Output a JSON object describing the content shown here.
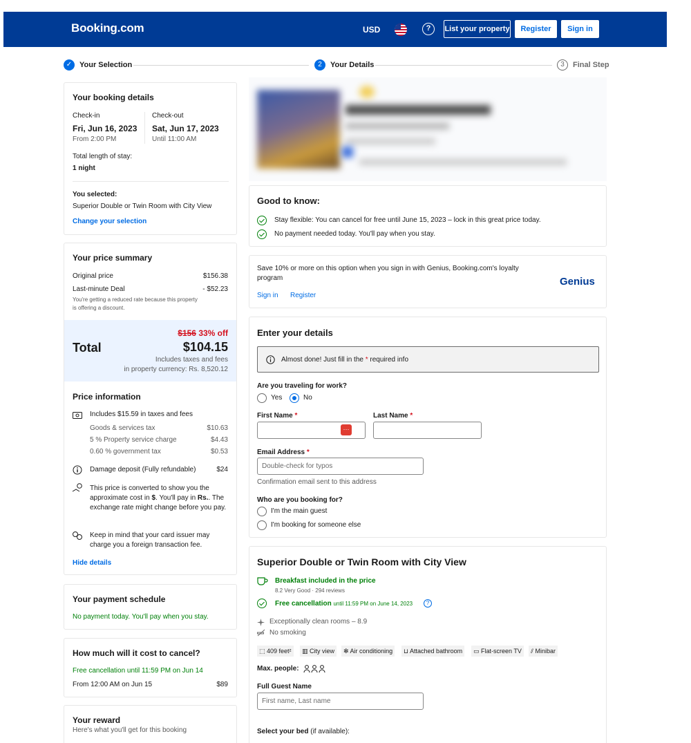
{
  "header": {
    "logo": "Booking.com",
    "currency": "USD",
    "help": "?",
    "list_property": "List your property",
    "register": "Register",
    "sign_in": "Sign in"
  },
  "progress": {
    "steps": [
      {
        "label": "Your Selection",
        "marker": "✓"
      },
      {
        "label": "Your Details",
        "marker": "2"
      },
      {
        "label": "Final Step",
        "marker": "3"
      }
    ]
  },
  "booking_details": {
    "title": "Your booking details",
    "checkin_label": "Check-in",
    "checkin_date": "Fri, Jun 16, 2023",
    "checkin_time": "From 2:00 PM",
    "checkout_label": "Check-out",
    "checkout_date": "Sat, Jun 17, 2023",
    "checkout_time": "Until 11:00 AM",
    "length_label": "Total length of stay:",
    "length_value": "1 night",
    "selected_label": "You selected:",
    "selected_value": "Superior Double or Twin Room with City View",
    "change_link": "Change your selection"
  },
  "price_summary": {
    "title": "Your price summary",
    "original_label": "Original price",
    "original_value": "$156.38",
    "deal_label": "Last-minute Deal",
    "deal_value": "- $52.23",
    "deal_note": "You're getting a reduced rate because this property is offering a discount.",
    "strike_price": "$156",
    "discount": "33% off",
    "total_label": "Total",
    "total_value": "$104.15",
    "taxes_note": "Includes taxes and fees",
    "property_currency": "in property currency: Rs. 8,520.12"
  },
  "price_info": {
    "title": "Price information",
    "taxes_line": "Includes $15.59 in taxes and fees",
    "tax_rows": [
      {
        "label": "Goods & services tax",
        "value": "$10.63"
      },
      {
        "label": "5 % Property service charge",
        "value": "$4.43"
      },
      {
        "label": "0.60 % government tax",
        "value": "$0.53"
      }
    ],
    "damage_label": "Damage deposit (Fully refundable)",
    "damage_value": "$24",
    "convert_pre": "This price is converted to show you the approximate cost in ",
    "convert_cur": "$",
    "convert_mid": ". You'll pay in ",
    "convert_pay": "Rs.",
    "convert_post": ". The exchange rate might change before you pay.",
    "card_note": "Keep in mind that your card issuer may charge you a foreign transaction fee.",
    "hide_link": "Hide details"
  },
  "payment_schedule": {
    "title": "Your payment schedule",
    "note": "No payment today. You'll pay when you stay."
  },
  "cancel_cost": {
    "title": "How much will it cost to cancel?",
    "free_note": "Free cancellation until 11:59 PM on Jun 14",
    "from_label": "From 12:00 AM on Jun 15",
    "from_value": "$89"
  },
  "reward": {
    "title": "Your reward",
    "subtitle": "Here's what you'll get for this booking"
  },
  "good_to_know": {
    "title": "Good to know:",
    "items": [
      "Stay flexible: You can cancel for free until June 15, 2023 – lock in this great price today.",
      "No payment needed today. You'll pay when you stay."
    ]
  },
  "genius": {
    "text": "Save 10% or more on this option when you sign in with Genius, Booking.com's loyalty program",
    "sign_in": "Sign in",
    "register": "Register",
    "logo": "Genius"
  },
  "details_form": {
    "title": "Enter your details",
    "info_pre": "Almost done! Just fill in the ",
    "info_star": "*",
    "info_post": " required info",
    "work_question": "Are you traveling for work?",
    "yes": "Yes",
    "no": "No",
    "first_name": "First Name",
    "last_name": "Last Name",
    "required": "*",
    "email_label": "Email Address",
    "email_placeholder": "Double-check for typos",
    "email_note": "Confirmation email sent to this address",
    "booking_for": "Who are you booking for?",
    "main_guest": "I'm the main guest",
    "someone_else": "I'm booking for someone else"
  },
  "room": {
    "title": "Superior Double or Twin Room with City View",
    "breakfast": "Breakfast included in the price",
    "rating": "8.2 Very Good",
    "reviews": "294 reviews",
    "free_cancel": "Free cancellation",
    "free_cancel_until": "until 11:59 PM on June 14, 2023",
    "clean": "Exceptionally clean rooms – 8.9",
    "smoking": "No smoking",
    "amenities": [
      "409 feet²",
      "City view",
      "Air conditioning",
      "Attached bathroom",
      "Flat-screen TV",
      "Minibar"
    ],
    "max_people": "Max. people:",
    "guest_name_label": "Full Guest Name",
    "guest_name_placeholder": "First name, Last name",
    "bed_label": "Select your bed",
    "bed_note": " (if available):"
  },
  "colors": {
    "brand": "#003b95",
    "link": "#006ce4",
    "green": "#008009",
    "red": "#d4111e"
  }
}
